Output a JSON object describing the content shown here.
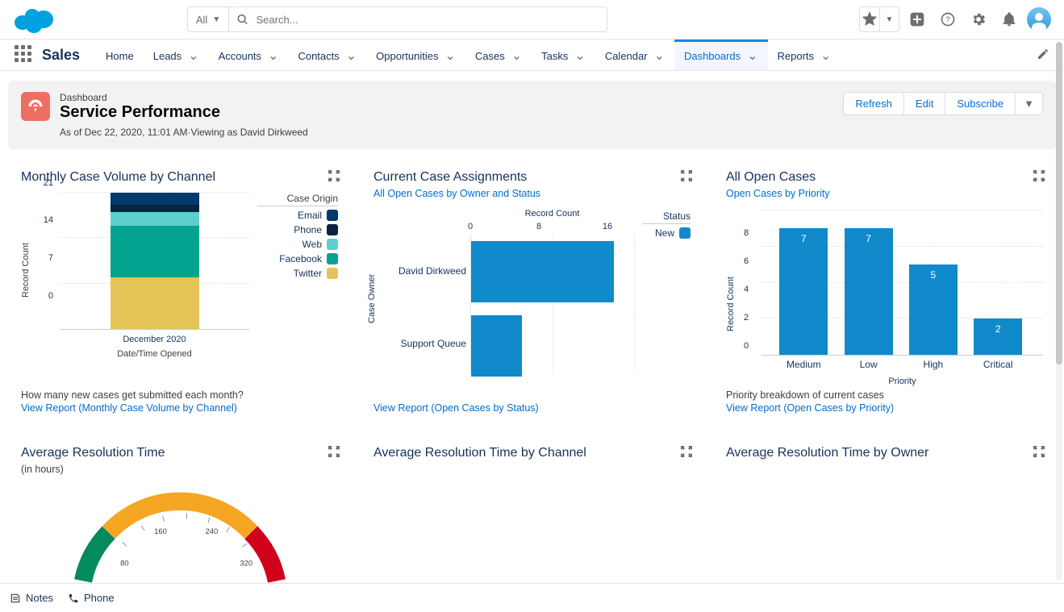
{
  "search": {
    "scope": "All",
    "placeholder": "Search..."
  },
  "appLauncher": {
    "appName": "Sales"
  },
  "nav": {
    "items": [
      {
        "label": "Home",
        "hasDropdown": false
      },
      {
        "label": "Leads",
        "hasDropdown": true
      },
      {
        "label": "Accounts",
        "hasDropdown": true
      },
      {
        "label": "Contacts",
        "hasDropdown": true
      },
      {
        "label": "Opportunities",
        "hasDropdown": true
      },
      {
        "label": "Cases",
        "hasDropdown": true
      },
      {
        "label": "Tasks",
        "hasDropdown": true
      },
      {
        "label": "Calendar",
        "hasDropdown": true
      },
      {
        "label": "Dashboards",
        "hasDropdown": true,
        "active": true
      },
      {
        "label": "Reports",
        "hasDropdown": true
      }
    ]
  },
  "header": {
    "objectType": "Dashboard",
    "title": "Service Performance",
    "asOf": "As of Dec 22, 2020, 11:01 AM·Viewing as David Dirkweed",
    "actions": {
      "refresh": "Refresh",
      "edit": "Edit",
      "subscribe": "Subscribe"
    }
  },
  "cards": {
    "c1": {
      "title": "Monthly Case Volume by Channel",
      "legendHeader": "Case Origin",
      "ylabel": "Record Count",
      "yticks": [
        "0",
        "7",
        "14",
        "21"
      ],
      "category": "December 2020",
      "xlabel": "Date/Time Opened",
      "legend": [
        {
          "name": "Email",
          "color": "#00396b"
        },
        {
          "name": "Phone",
          "color": "#0a2340"
        },
        {
          "name": "Web",
          "color": "#5ecfcf"
        },
        {
          "name": "Facebook",
          "color": "#04a38f"
        },
        {
          "name": "Twitter",
          "color": "#e4c456"
        }
      ],
      "descText": "How many new cases get submitted each month?",
      "linkText": "View Report (Monthly Case Volume by Channel)"
    },
    "c2": {
      "title": "Current Case Assignments",
      "subtitle": "All Open Cases by Owner and Status",
      "xlabel": "Record Count",
      "ylabel": "Case Owner",
      "xticks": [
        "0",
        "8",
        "16"
      ],
      "categories": [
        "David Dirkweed",
        "Support Queue"
      ],
      "statusHeader": "Status",
      "statusItem": "New",
      "linkText": "View Report (Open Cases by Status)"
    },
    "c3": {
      "title": "All Open Cases",
      "subtitle": "Open Cases by Priority",
      "ylabel": "Record Count",
      "yticks": [
        "0",
        "2",
        "4",
        "6",
        "8"
      ],
      "xlabel": "Priority",
      "categories": [
        "Medium",
        "Low",
        "High",
        "Critical"
      ],
      "values": [
        "7",
        "7",
        "5",
        "2"
      ],
      "descText": "Priority breakdown of current cases",
      "linkText": "View Report (Open Cases by Priority)"
    },
    "c4": {
      "title": "Average Resolution Time",
      "subtitle": "(in hours)",
      "ticks": [
        "80",
        "160",
        "240",
        "320"
      ]
    },
    "c5": {
      "title": "Average Resolution Time by Channel"
    },
    "c6": {
      "title": "Average Resolution Time by Owner"
    }
  },
  "util": {
    "notes": "Notes",
    "phone": "Phone"
  },
  "chart_data": [
    {
      "type": "bar",
      "stacked": true,
      "title": "Monthly Case Volume by Channel",
      "xlabel": "Date/Time Opened",
      "ylabel": "Record Count",
      "categories": [
        "December 2020"
      ],
      "ylim": [
        0,
        21
      ],
      "series": [
        {
          "name": "Twitter",
          "values": [
            8
          ],
          "color": "#e4c456"
        },
        {
          "name": "Facebook",
          "values": [
            8
          ],
          "color": "#04a38f"
        },
        {
          "name": "Web",
          "values": [
            2
          ],
          "color": "#5ecfcf"
        },
        {
          "name": "Phone",
          "values": [
            1
          ],
          "color": "#0a2340"
        },
        {
          "name": "Email",
          "values": [
            2
          ],
          "color": "#00396b"
        }
      ],
      "legend_title": "Case Origin"
    },
    {
      "type": "bar",
      "orientation": "horizontal",
      "title": "Current Case Assignments",
      "subtitle": "All Open Cases by Owner and Status",
      "xlabel": "Record Count",
      "ylabel": "Case Owner",
      "xlim": [
        0,
        16
      ],
      "categories": [
        "David Dirkweed",
        "Support Queue"
      ],
      "series": [
        {
          "name": "New",
          "values": [
            14,
            5
          ],
          "color": "#118acb"
        }
      ],
      "legend_title": "Status"
    },
    {
      "type": "bar",
      "title": "All Open Cases",
      "subtitle": "Open Cases by Priority",
      "xlabel": "Priority",
      "ylabel": "Record Count",
      "ylim": [
        0,
        8
      ],
      "categories": [
        "Medium",
        "Low",
        "High",
        "Critical"
      ],
      "values": [
        7,
        7,
        5,
        2
      ],
      "color": "#118acb"
    },
    {
      "type": "gauge",
      "title": "Average Resolution Time",
      "subtitle": "(in hours)",
      "range": [
        0,
        400
      ],
      "ticks": [
        80,
        160,
        240,
        320
      ],
      "bands": [
        {
          "from": 0,
          "to": 100,
          "color": "#048a5f"
        },
        {
          "from": 100,
          "to": 300,
          "color": "#f5a623"
        },
        {
          "from": 300,
          "to": 400,
          "color": "#d0021b"
        }
      ]
    }
  ]
}
